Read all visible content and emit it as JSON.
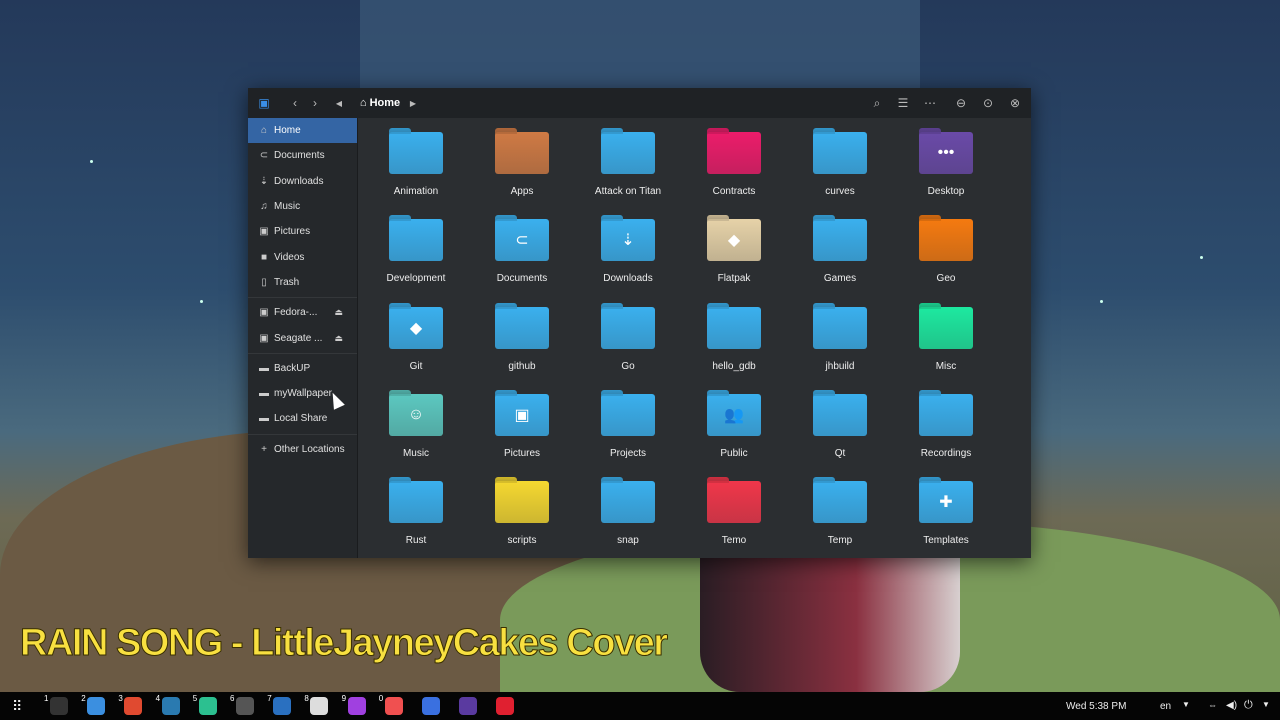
{
  "window": {
    "location": "Home"
  },
  "sidebar": {
    "items": [
      {
        "label": "Home",
        "icon": "home-icon",
        "char": "⌂",
        "active": true
      },
      {
        "label": "Documents",
        "icon": "documents-icon",
        "char": "⊂"
      },
      {
        "label": "Downloads",
        "icon": "download-icon",
        "char": "⇣"
      },
      {
        "label": "Music",
        "icon": "music-icon",
        "char": "♫"
      },
      {
        "label": "Pictures",
        "icon": "pictures-icon",
        "char": "▣"
      },
      {
        "label": "Videos",
        "icon": "videos-icon",
        "char": "■"
      },
      {
        "label": "Trash",
        "icon": "trash-icon",
        "char": "▯"
      }
    ],
    "devices": [
      {
        "label": "Fedora-...",
        "icon": "drive-icon"
      },
      {
        "label": "Seagate ...",
        "icon": "drive-icon"
      }
    ],
    "bookmarks": [
      {
        "label": "BackUP"
      },
      {
        "label": "myWallpaper"
      },
      {
        "label": "Local Share"
      }
    ],
    "other": "Other Locations"
  },
  "files": [
    {
      "name": "Animation",
      "color": "#3ab0ee"
    },
    {
      "name": "Apps",
      "color": "#cf7a44"
    },
    {
      "name": "Attack on Titan",
      "color": "#3ab0ee"
    },
    {
      "name": "Contracts",
      "color": "#ec1c6a"
    },
    {
      "name": "curves",
      "color": "#3ab0ee"
    },
    {
      "name": "Desktop",
      "color": "#6a4aa8",
      "glyph": "•••"
    },
    {
      "name": "Development",
      "color": "#3ab0ee"
    },
    {
      "name": "Documents",
      "color": "#3ab0ee",
      "glyph": "⊂"
    },
    {
      "name": "Downloads",
      "color": "#3ab0ee",
      "glyph": "⇣"
    },
    {
      "name": "Flatpak",
      "color": "#e6d2a8",
      "glyph": "◆"
    },
    {
      "name": "Games",
      "color": "#3ab0ee"
    },
    {
      "name": "Geo",
      "color": "#f57a10"
    },
    {
      "name": "Git",
      "color": "#3ab0ee",
      "glyph": "◆"
    },
    {
      "name": "github",
      "color": "#3ab0ee"
    },
    {
      "name": "Go",
      "color": "#3ab0ee"
    },
    {
      "name": "hello_gdb",
      "color": "#3ab0ee"
    },
    {
      "name": "jhbuild",
      "color": "#3ab0ee"
    },
    {
      "name": "Misc",
      "color": "#1de9a0"
    },
    {
      "name": "Music",
      "color": "#5cc8c0",
      "glyph": "☺"
    },
    {
      "name": "Pictures",
      "color": "#3ab0ee",
      "glyph": "▣"
    },
    {
      "name": "Projects",
      "color": "#3ab0ee"
    },
    {
      "name": "Public",
      "color": "#3ab0ee",
      "glyph": "👥"
    },
    {
      "name": "Qt",
      "color": "#3ab0ee"
    },
    {
      "name": "Recordings",
      "color": "#3ab0ee"
    },
    {
      "name": "Rust",
      "color": "#3ab0ee"
    },
    {
      "name": "scripts",
      "color": "#f5d830"
    },
    {
      "name": "snap",
      "color": "#3ab0ee"
    },
    {
      "name": "Temo",
      "color": "#f0364a"
    },
    {
      "name": "Temp",
      "color": "#3ab0ee"
    },
    {
      "name": "Templates",
      "color": "#3ab0ee",
      "glyph": "✚"
    }
  ],
  "overlay_title": "RAIN SONG - LittleJayneyCakes Cover",
  "taskbar": {
    "apps": [
      {
        "num": "1",
        "name": "terminal",
        "color": "#333"
      },
      {
        "num": "2",
        "name": "files",
        "color": "#3b8fe0"
      },
      {
        "num": "3",
        "name": "chrome",
        "color": "#e04a30"
      },
      {
        "num": "4",
        "name": "app4",
        "color": "#2a7ab0"
      },
      {
        "num": "5",
        "name": "app5",
        "color": "#2cc090"
      },
      {
        "num": "6",
        "name": "settings",
        "color": "#555"
      },
      {
        "num": "7",
        "name": "app7",
        "color": "#2a70c0"
      },
      {
        "num": "8",
        "name": "text-editor",
        "color": "#ddd"
      },
      {
        "num": "9",
        "name": "media-player",
        "color": "#a040e0"
      },
      {
        "num": "0",
        "name": "screenshot",
        "color": "#f05050"
      },
      {
        "num": "",
        "name": "firefox",
        "color": "#3a70e0"
      },
      {
        "num": "",
        "name": "app-3",
        "color": "#5a3aa0"
      },
      {
        "num": "",
        "name": "recorder",
        "color": "#e02030"
      }
    ],
    "clock": "Wed  5:38 PM",
    "lang": "en"
  }
}
